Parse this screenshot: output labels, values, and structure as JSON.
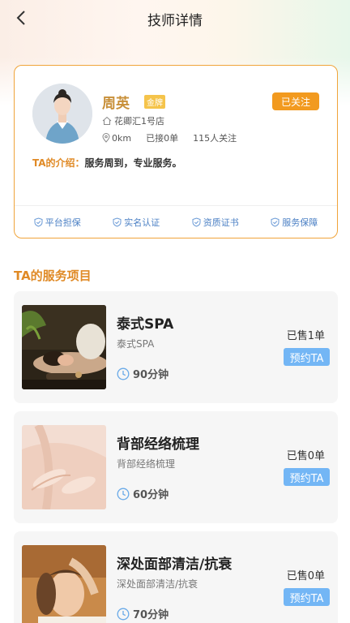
{
  "header": {
    "title": "技师详情"
  },
  "profile": {
    "name": "周英",
    "badge": "金牌",
    "follow_label": "已关注",
    "store": "花卿汇1号店",
    "distance": "0km",
    "orders": "已接0单",
    "followers": "115人关注",
    "intro_label": "TA的介绍：",
    "intro_text": "服务周到，专业服务。"
  },
  "guarantees": [
    {
      "label": "平台担保",
      "icon": "shield-check-icon"
    },
    {
      "label": "实名认证",
      "icon": "shield-check-icon"
    },
    {
      "label": "资质证书",
      "icon": "shield-check-icon"
    },
    {
      "label": "服务保障",
      "icon": "shield-check-icon"
    }
  ],
  "services_title": "TA的服务项目",
  "services": [
    {
      "title": "泰式SPA",
      "subtitle": "泰式SPA",
      "duration": "90分钟",
      "sold": "已售1单",
      "book_label": "预约TA"
    },
    {
      "title": "背部经络梳理",
      "subtitle": "背部经络梳理",
      "duration": "60分钟",
      "sold": "已售0单",
      "book_label": "预约TA"
    },
    {
      "title": "深处面部清洁/抗衰",
      "subtitle": "深处面部清洁/抗衰",
      "duration": "70分钟",
      "sold": "已售0单",
      "book_label": "预约TA"
    }
  ],
  "colors": {
    "accent_orange": "#f29a1f",
    "name_gold": "#c8903a",
    "card_border": "#f0a43a",
    "guarantee_blue": "#4a7fc4",
    "book_button": "#73b6f5"
  }
}
